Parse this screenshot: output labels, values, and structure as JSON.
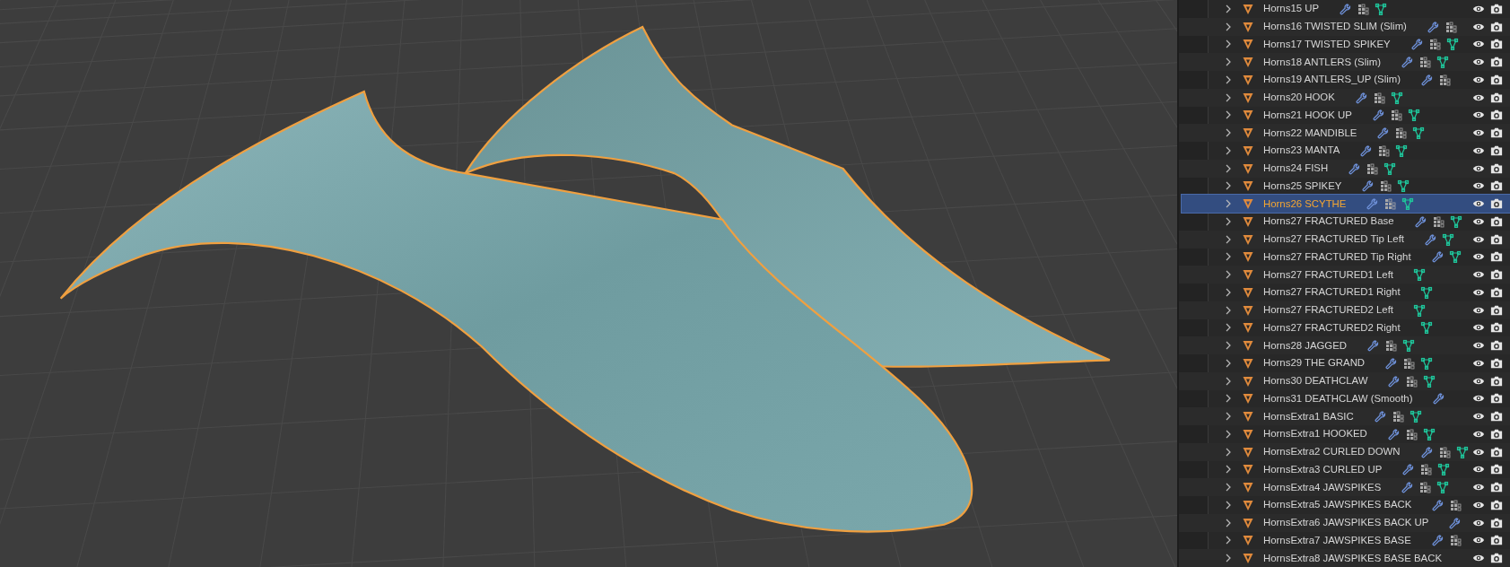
{
  "outliner": {
    "rows": [
      {
        "name": "Horns15 UP",
        "selected": false,
        "modifiers": true,
        "vertex_groups": true,
        "mesh_data": true
      },
      {
        "name": "Horns16 TWISTED SLIM (Slim)",
        "selected": false,
        "modifiers": true,
        "vertex_groups": true,
        "mesh_data": false
      },
      {
        "name": "Horns17 TWISTED SPIKEY",
        "selected": false,
        "modifiers": true,
        "vertex_groups": true,
        "mesh_data": true
      },
      {
        "name": "Horns18 ANTLERS (Slim)",
        "selected": false,
        "modifiers": true,
        "vertex_groups": true,
        "mesh_data": true
      },
      {
        "name": "Horns19 ANTLERS_UP (Slim)",
        "selected": false,
        "modifiers": true,
        "vertex_groups": true,
        "mesh_data": false
      },
      {
        "name": "Horns20 HOOK",
        "selected": false,
        "modifiers": true,
        "vertex_groups": true,
        "mesh_data": true
      },
      {
        "name": "Horns21 HOOK UP",
        "selected": false,
        "modifiers": true,
        "vertex_groups": true,
        "mesh_data": true
      },
      {
        "name": "Horns22 MANDIBLE",
        "selected": false,
        "modifiers": true,
        "vertex_groups": true,
        "mesh_data": true
      },
      {
        "name": "Horns23 MANTA",
        "selected": false,
        "modifiers": true,
        "vertex_groups": true,
        "mesh_data": true
      },
      {
        "name": "Horns24 FISH",
        "selected": false,
        "modifiers": true,
        "vertex_groups": true,
        "mesh_data": true
      },
      {
        "name": "Horns25 SPIKEY",
        "selected": false,
        "modifiers": true,
        "vertex_groups": true,
        "mesh_data": true
      },
      {
        "name": "Horns26 SCYTHE",
        "selected": true,
        "modifiers": true,
        "vertex_groups": true,
        "mesh_data": true
      },
      {
        "name": "Horns27 FRACTURED Base",
        "selected": false,
        "modifiers": true,
        "vertex_groups": true,
        "mesh_data": true
      },
      {
        "name": "Horns27 FRACTURED Tip Left",
        "selected": false,
        "modifiers": true,
        "vertex_groups": false,
        "mesh_data": true
      },
      {
        "name": "Horns27 FRACTURED Tip Right",
        "selected": false,
        "modifiers": true,
        "vertex_groups": false,
        "mesh_data": true
      },
      {
        "name": "Horns27 FRACTURED1 Left",
        "selected": false,
        "modifiers": false,
        "vertex_groups": false,
        "mesh_data": true
      },
      {
        "name": "Horns27 FRACTURED1 Right",
        "selected": false,
        "modifiers": false,
        "vertex_groups": false,
        "mesh_data": true
      },
      {
        "name": "Horns27 FRACTURED2 Left",
        "selected": false,
        "modifiers": false,
        "vertex_groups": false,
        "mesh_data": true
      },
      {
        "name": "Horns27 FRACTURED2 Right",
        "selected": false,
        "modifiers": false,
        "vertex_groups": false,
        "mesh_data": true
      },
      {
        "name": "Horns28 JAGGED",
        "selected": false,
        "modifiers": true,
        "vertex_groups": true,
        "mesh_data": true
      },
      {
        "name": "Horns29 THE GRAND",
        "selected": false,
        "modifiers": true,
        "vertex_groups": true,
        "mesh_data": true
      },
      {
        "name": "Horns30 DEATHCLAW",
        "selected": false,
        "modifiers": true,
        "vertex_groups": true,
        "mesh_data": true
      },
      {
        "name": "Horns31 DEATHCLAW (Smooth)",
        "selected": false,
        "modifiers": true,
        "vertex_groups": false,
        "mesh_data": false
      },
      {
        "name": "HornsExtra1 BASIC",
        "selected": false,
        "modifiers": true,
        "vertex_groups": true,
        "mesh_data": true
      },
      {
        "name": "HornsExtra1 HOOKED",
        "selected": false,
        "modifiers": true,
        "vertex_groups": true,
        "mesh_data": true
      },
      {
        "name": "HornsExtra2 CURLED DOWN",
        "selected": false,
        "modifiers": true,
        "vertex_groups": true,
        "mesh_data": true
      },
      {
        "name": "HornsExtra3 CURLED UP",
        "selected": false,
        "modifiers": true,
        "vertex_groups": true,
        "mesh_data": true
      },
      {
        "name": "HornsExtra4 JAWSPIKES",
        "selected": false,
        "modifiers": true,
        "vertex_groups": true,
        "mesh_data": true
      },
      {
        "name": "HornsExtra5 JAWSPIKES BACK",
        "selected": false,
        "modifiers": true,
        "vertex_groups": true,
        "mesh_data": false
      },
      {
        "name": "HornsExtra6 JAWSPIKES BACK UP",
        "selected": false,
        "modifiers": true,
        "vertex_groups": false,
        "mesh_data": false
      },
      {
        "name": "HornsExtra7 JAWSPIKES BASE",
        "selected": false,
        "modifiers": true,
        "vertex_groups": true,
        "mesh_data": false
      },
      {
        "name": "HornsExtra8 JAWSPIKES BASE BACK",
        "selected": false,
        "modifiers": false,
        "vertex_groups": false,
        "mesh_data": false
      }
    ]
  }
}
